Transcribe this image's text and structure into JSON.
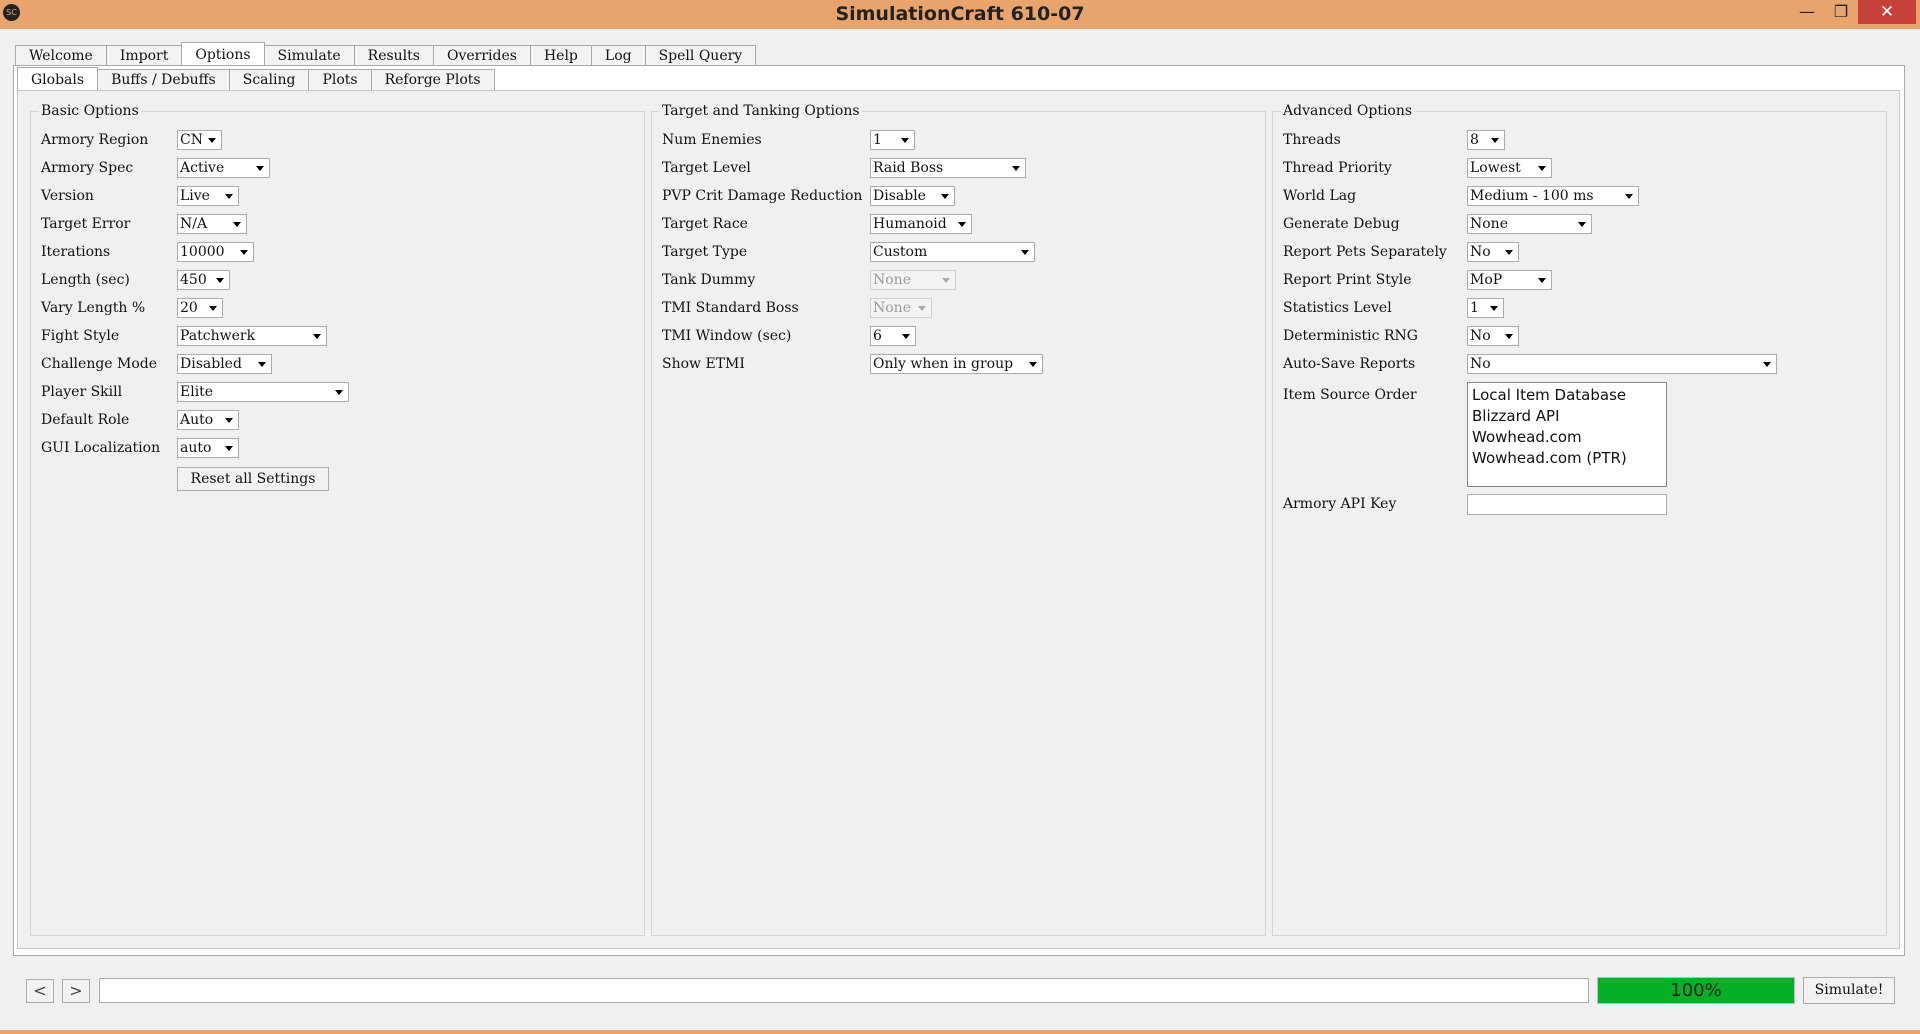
{
  "window": {
    "title": "SimulationCraft 610-07",
    "icon_text": "SC",
    "minimize": "—",
    "maximize": "❐",
    "close": "✕"
  },
  "main_tabs": [
    "Welcome",
    "Import",
    "Options",
    "Simulate",
    "Results",
    "Overrides",
    "Help",
    "Log",
    "Spell Query"
  ],
  "main_tab_active": "Options",
  "sub_tabs": [
    "Globals",
    "Buffs / Debuffs",
    "Scaling",
    "Plots",
    "Reforge Plots"
  ],
  "sub_tab_active": "Globals",
  "basic": {
    "title": "Basic Options",
    "rows": [
      {
        "label": "Armory Region",
        "value": "CN"
      },
      {
        "label": "Armory Spec",
        "value": "Active"
      },
      {
        "label": "Version",
        "value": "Live"
      },
      {
        "label": "Target Error",
        "value": "N/A"
      },
      {
        "label": "Iterations",
        "value": "10000"
      },
      {
        "label": "Length (sec)",
        "value": "450"
      },
      {
        "label": "Vary Length %",
        "value": "20"
      },
      {
        "label": "Fight Style",
        "value": "Patchwerk"
      },
      {
        "label": "Challenge Mode",
        "value": "Disabled"
      },
      {
        "label": "Player Skill",
        "value": "Elite"
      },
      {
        "label": "Default Role",
        "value": "Auto"
      },
      {
        "label": "GUI Localization",
        "value": "auto"
      }
    ],
    "reset_label": "Reset all Settings"
  },
  "target": {
    "title": "Target and Tanking Options",
    "rows": [
      {
        "label": "Num Enemies",
        "value": "1"
      },
      {
        "label": "Target Level",
        "value": "Raid Boss"
      },
      {
        "label": "PVP Crit Damage Reduction",
        "value": "Disable"
      },
      {
        "label": "Target Race",
        "value": "Humanoid"
      },
      {
        "label": "Target Type",
        "value": "Custom"
      },
      {
        "label": "Tank Dummy",
        "value": "None"
      },
      {
        "label": "TMI Standard Boss",
        "value": "None"
      },
      {
        "label": "TMI Window (sec)",
        "value": "6"
      },
      {
        "label": "Show ETMI",
        "value": "Only when in group"
      }
    ]
  },
  "advanced": {
    "title": "Advanced Options",
    "rows": [
      {
        "label": "Threads",
        "value": "8"
      },
      {
        "label": "Thread Priority",
        "value": "Lowest"
      },
      {
        "label": "World Lag",
        "value": "Medium - 100 ms"
      },
      {
        "label": "Generate Debug",
        "value": "None"
      },
      {
        "label": "Report Pets Separately",
        "value": "No"
      },
      {
        "label": "Report Print Style",
        "value": "MoP"
      },
      {
        "label": "Statistics Level",
        "value": "1"
      },
      {
        "label": "Deterministic RNG",
        "value": "No"
      },
      {
        "label": "Auto-Save Reports",
        "value": "No"
      }
    ],
    "item_source_label": "Item Source Order",
    "item_sources": [
      "Local Item Database",
      "Blizzard API",
      "Wowhead.com",
      "Wowhead.com (PTR)"
    ],
    "api_key_label": "Armory API Key",
    "api_key_value": ""
  },
  "bottom": {
    "back": "<",
    "forward": ">",
    "url_value": "",
    "progress_percent": 100,
    "progress_text": "100%",
    "simulate_label": "Simulate!"
  },
  "colors": {
    "titlebar": "#e8a46c",
    "progress_fill": "#06b025",
    "close": "#c7403a"
  }
}
